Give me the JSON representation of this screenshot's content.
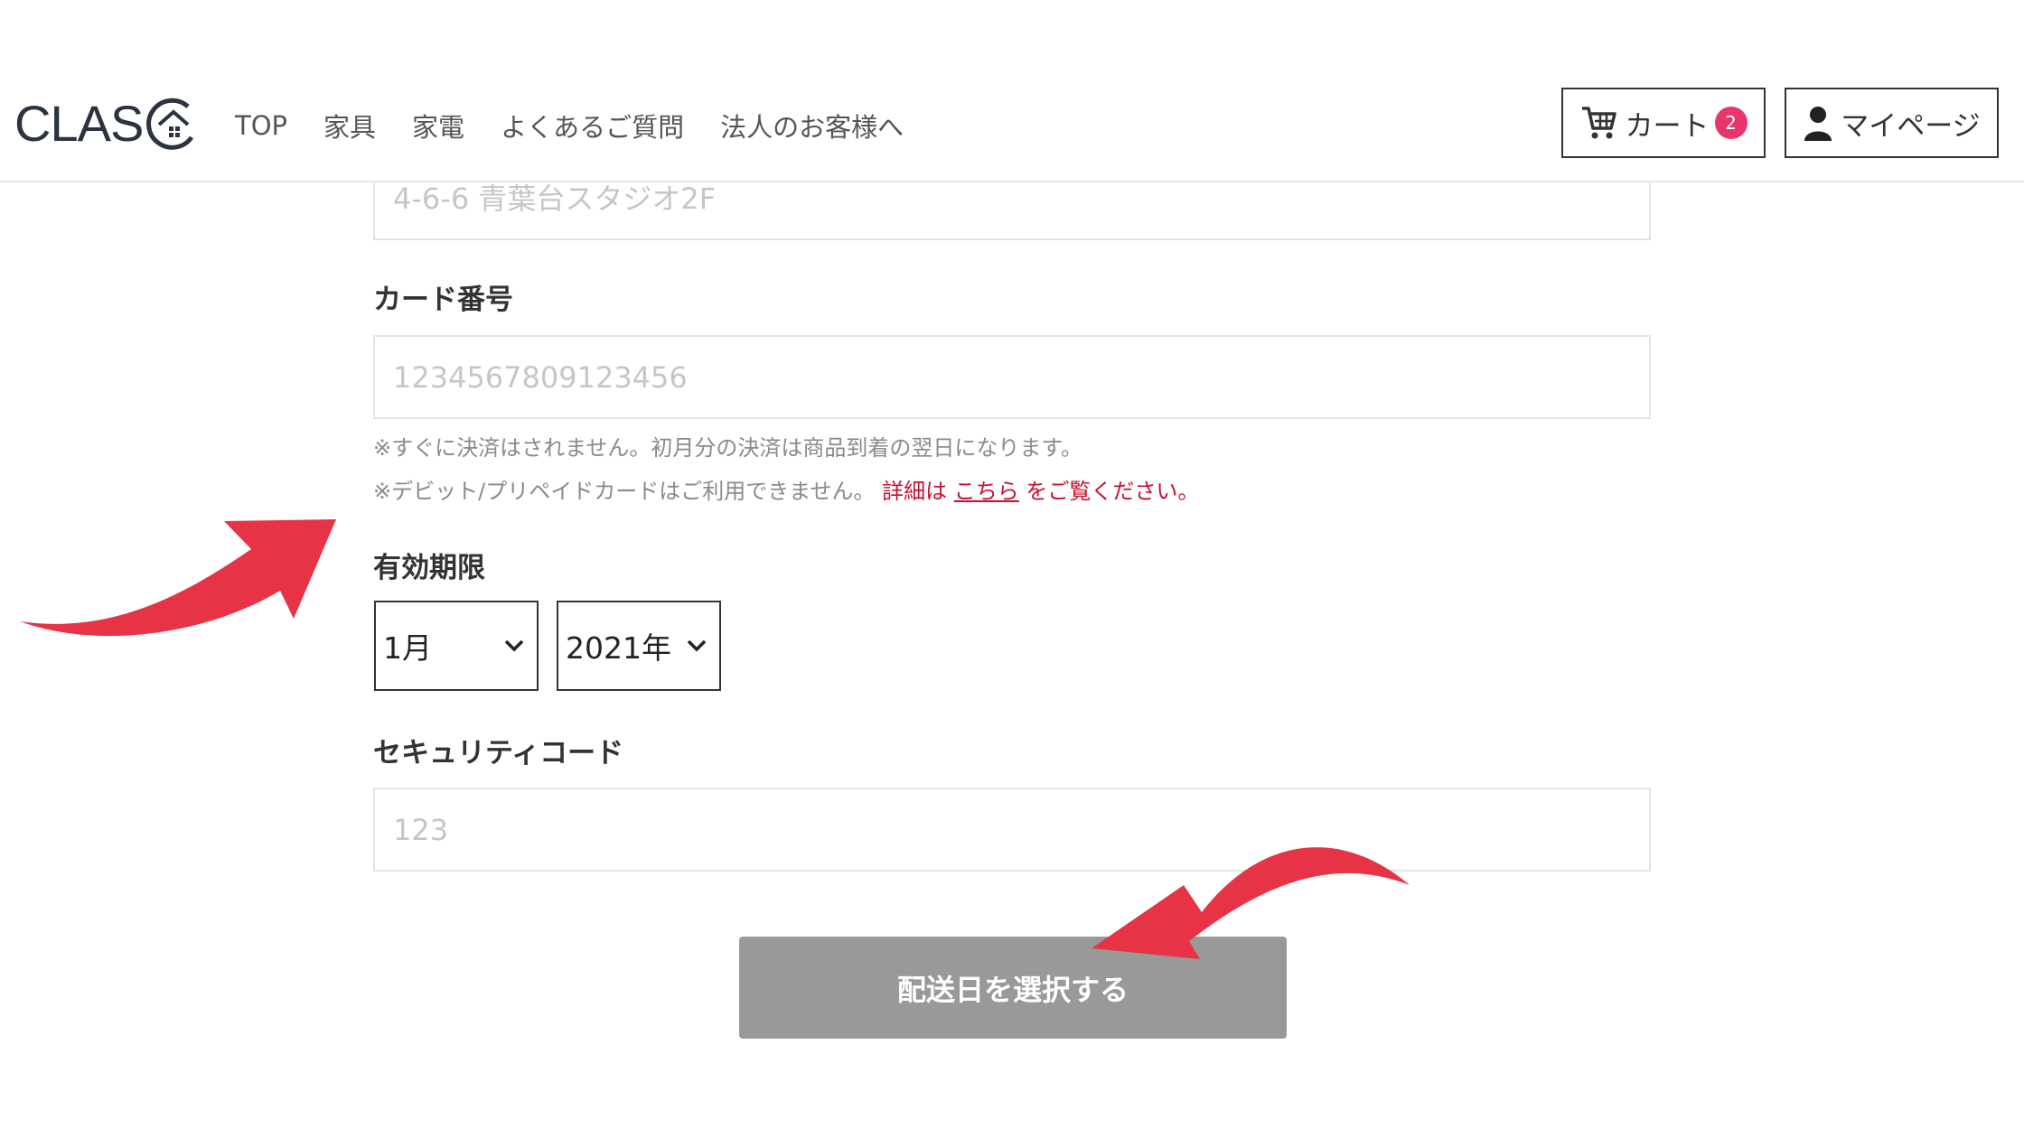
{
  "header": {
    "logo_text": "CLAS",
    "nav": [
      "TOP",
      "家具",
      "家電",
      "よくあるご質問",
      "法人のお客様へ"
    ],
    "cart_label": "カート",
    "cart_count": "2",
    "mypage_label": "マイページ"
  },
  "form": {
    "address_placeholder": "4-6-6 青葉台スタジオ2F",
    "card_number_label": "カード番号",
    "card_number_placeholder": "1234567809123456",
    "note1": "※すぐに決済はされません。初月分の決済は商品到着の翌日になります。",
    "note2_prefix": "※デビット/プリペイドカードはご利用できません。",
    "note2_detail": "詳細は",
    "note2_link": "こちら",
    "note2_suffix": "をご覧ください。",
    "expiry_label": "有効期限",
    "month_value": "1月",
    "year_value": "2021年",
    "security_label": "セキュリティコード",
    "security_placeholder": "123",
    "submit_label": "配送日を選択する"
  },
  "colors": {
    "arrow": "#e63346",
    "badge": "#e8356a",
    "submit_bg": "#999999",
    "link": "#c8102e"
  },
  "icons": [
    "cart-icon",
    "user-icon",
    "chevron-down-icon",
    "logo-house-icon"
  ]
}
